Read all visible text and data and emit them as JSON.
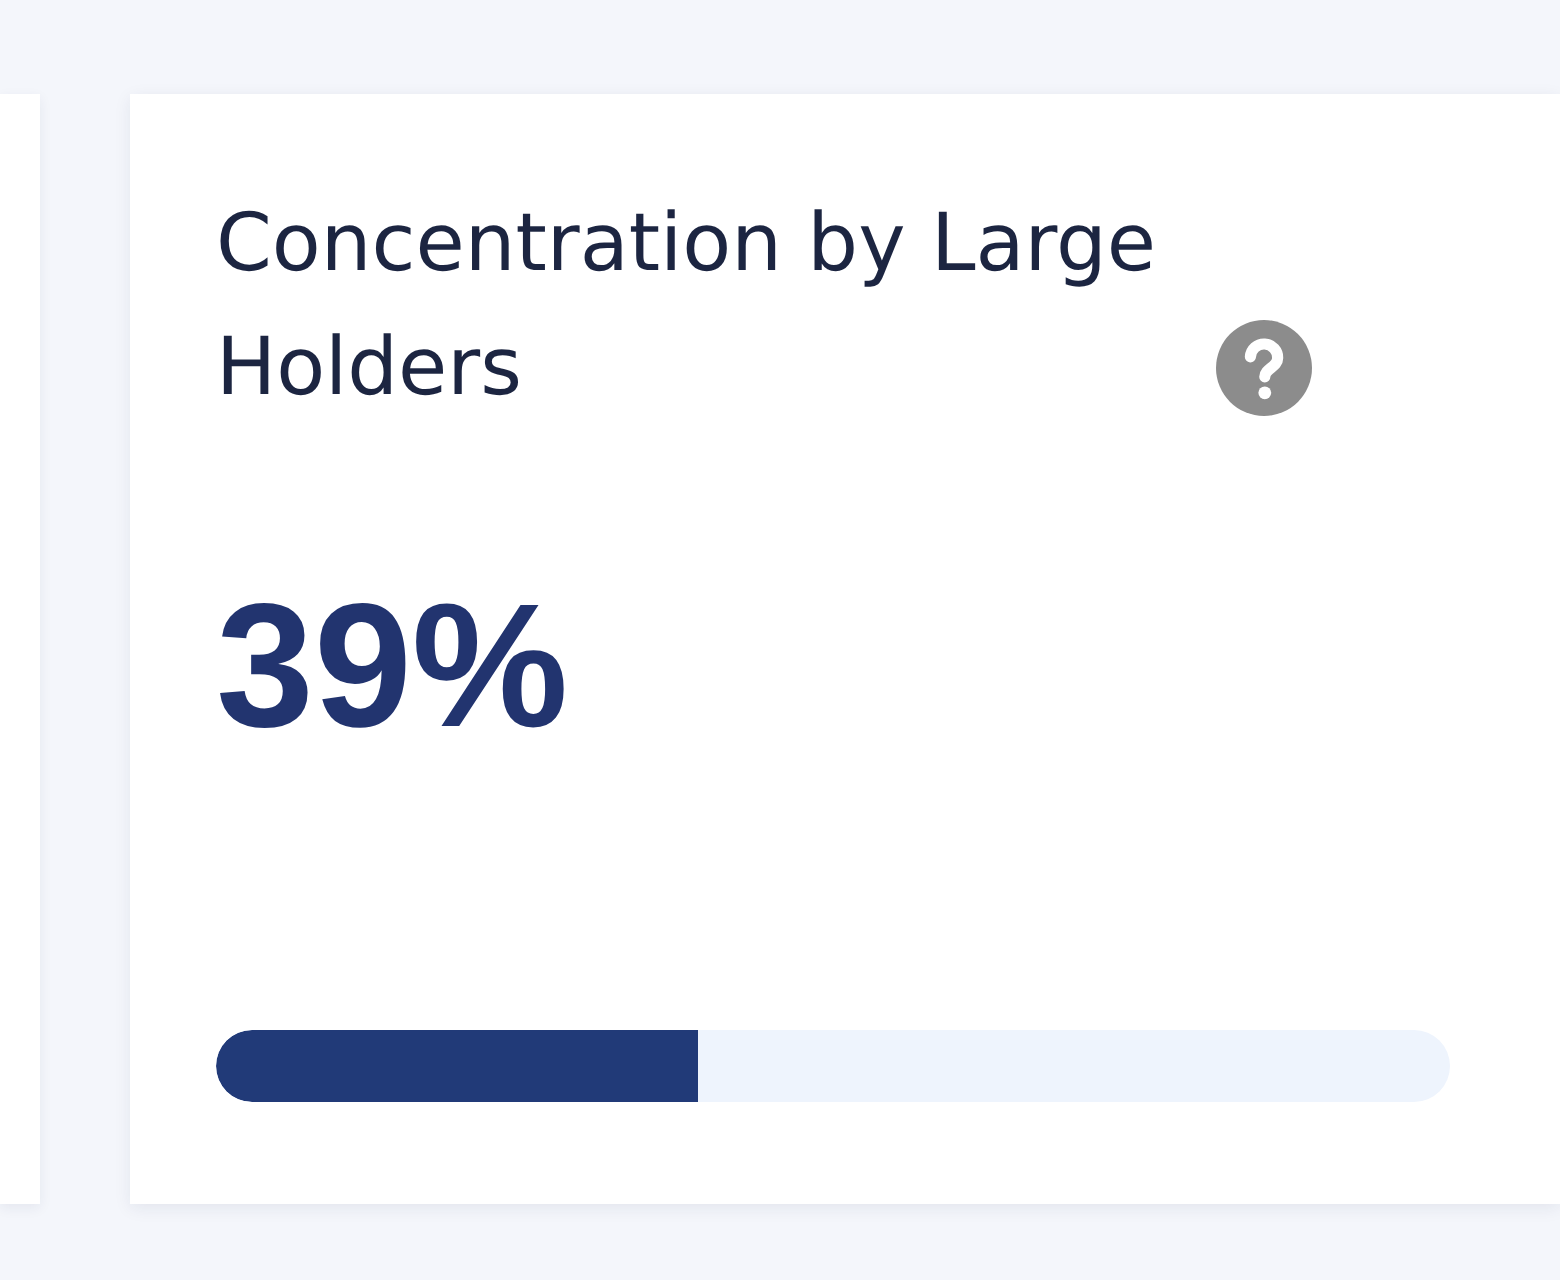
{
  "cards": [
    {
      "title": "Concentration by Large Holders",
      "help": true,
      "value": "39%",
      "level": 0.39
    }
  ]
}
